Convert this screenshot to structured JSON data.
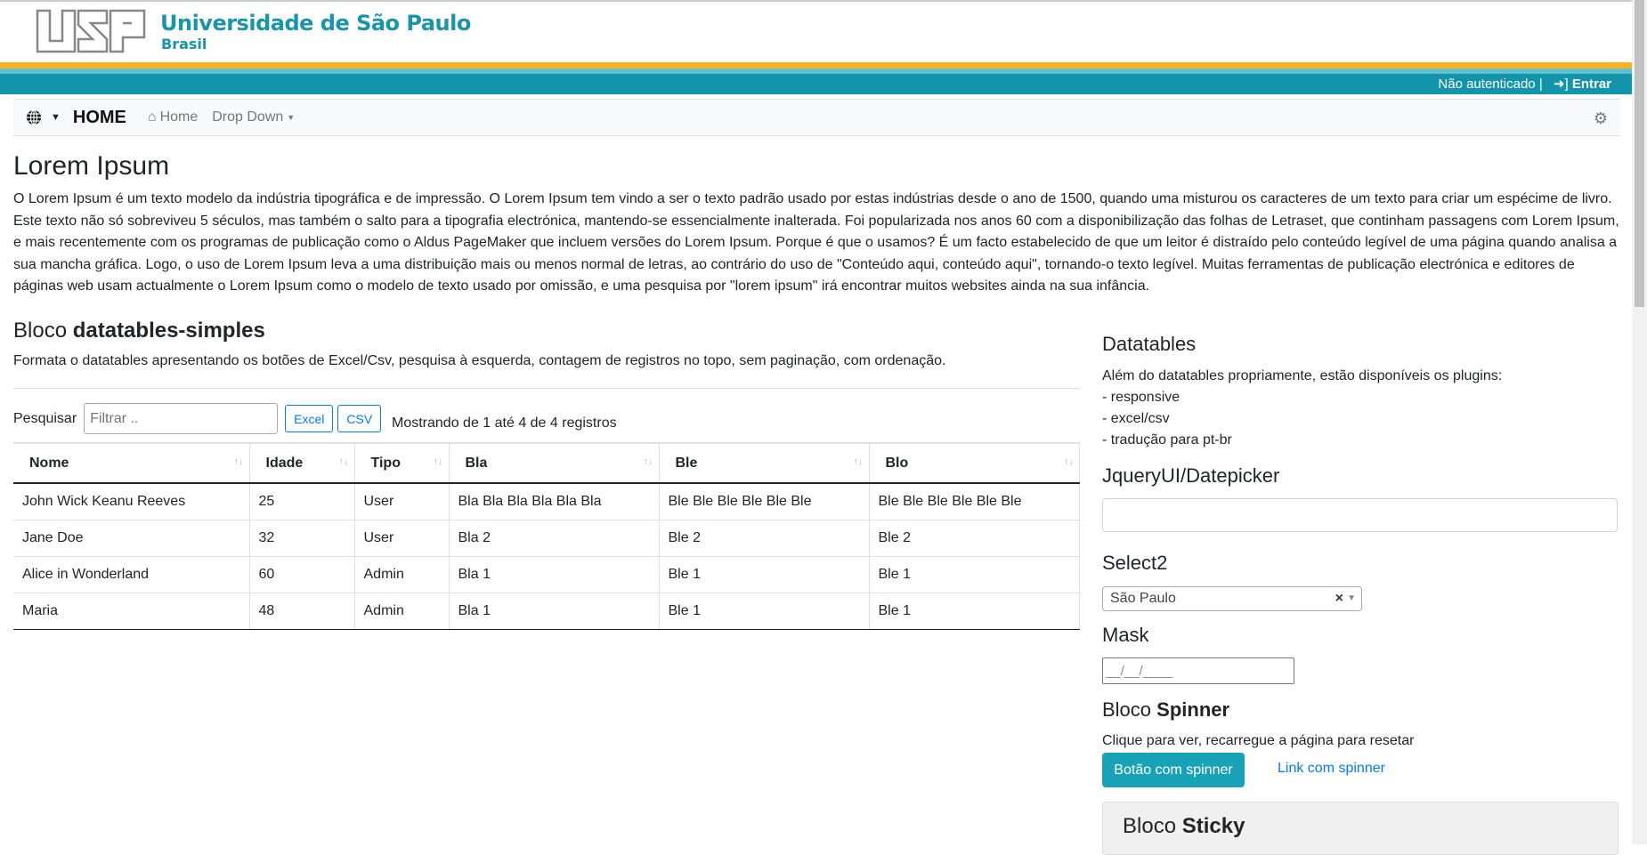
{
  "header": {
    "logo_text": "USP",
    "university": "Universidade de São Paulo",
    "country": "Brasil",
    "auth_status": "Não autenticado |",
    "login_label": "Entrar"
  },
  "navbar": {
    "brand": "HOME",
    "items": [
      {
        "label": "Home"
      },
      {
        "label": "Drop Down"
      }
    ]
  },
  "intro": {
    "title": "Lorem Ipsum",
    "text": "O Lorem Ipsum é um texto modelo da indústria tipográfica e de impressão. O Lorem Ipsum tem vindo a ser o texto padrão usado por estas indústrias desde o ano de 1500, quando uma misturou os caracteres de um texto para criar um espécime de livro. Este texto não só sobreviveu 5 séculos, mas também o salto para a tipografia electrónica, mantendo-se essencialmente inalterada. Foi popularizada nos anos 60 com a disponibilização das folhas de Letraset, que continham passagens com Lorem Ipsum, e mais recentemente com os programas de publicação como o Aldus PageMaker que incluem versões do Lorem Ipsum. Porque é que o usamos? É um facto estabelecido de que um leitor é distraído pelo conteúdo legível de uma página quando analisa a sua mancha gráfica. Logo, o uso de Lorem Ipsum leva a uma distribuição mais ou menos normal de letras, ao contrário do uso de \"Conteúdo aqui, conteúdo aqui\", tornando-o texto legível. Muitas ferramentas de publicação electrónica e editores de páginas web usam actualmente o Lorem Ipsum como o modelo de texto usado por omissão, e uma pesquisa por \"lorem ipsum\" irá encontrar muitos websites ainda na sua infância."
  },
  "datatable": {
    "title_prefix": "Bloco",
    "title_bold": "datatables-simples",
    "description": "Formata o datatables apresentando os botões de Excel/Csv, pesquisa à esquerda, contagem de registros no topo, sem paginação, com ordenação.",
    "search_label": "Pesquisar",
    "search_placeholder": "Filtrar ..",
    "excel_label": "Excel",
    "csv_label": "CSV",
    "info": "Mostrando de 1 até 4 de 4 registros",
    "columns": [
      "Nome",
      "Idade",
      "Tipo",
      "Bla",
      "Ble",
      "Blo"
    ],
    "rows": [
      [
        "John Wick Keanu Reeves",
        "25",
        "User",
        "Bla Bla Bla Bla Bla Bla",
        "Ble Ble Ble Ble Ble Ble",
        "Ble Ble Ble Ble Ble Ble"
      ],
      [
        "Jane Doe",
        "32",
        "User",
        "Bla 2",
        "Ble 2",
        "Ble 2"
      ],
      [
        "Alice in Wonderland",
        "60",
        "Admin",
        "Bla 1",
        "Ble 1",
        "Ble 1"
      ],
      [
        "Maria",
        "48",
        "Admin",
        "Bla 1",
        "Ble 1",
        "Ble 1"
      ]
    ]
  },
  "sidebar": {
    "datatables_title": "Datatables",
    "datatables_items": [
      "Além do datatables propriamente, estão disponíveis os plugins:",
      "- responsive",
      "- excel/csv",
      "- tradução para pt-br"
    ],
    "datepicker_title": "JqueryUI/Datepicker",
    "select2_title": "Select2",
    "select2_value": "São Paulo",
    "select2_clear": "×",
    "mask_title": "Mask",
    "mask_value": "__/__/____",
    "spinner_prefix": "Bloco",
    "spinner_bold": "Spinner",
    "spinner_text": "Clique para ver, recarregue a página para resetar",
    "spinner_button": "Botão com spinner",
    "spinner_link": "Link com spinner",
    "sticky_prefix": "Bloco",
    "sticky_bold": "Sticky"
  },
  "colors": {
    "teal": "#1294ab",
    "orange": "#f9b121",
    "light_teal": "#60c2d1",
    "info_button": "#17a2b8",
    "link": "#007bff"
  }
}
